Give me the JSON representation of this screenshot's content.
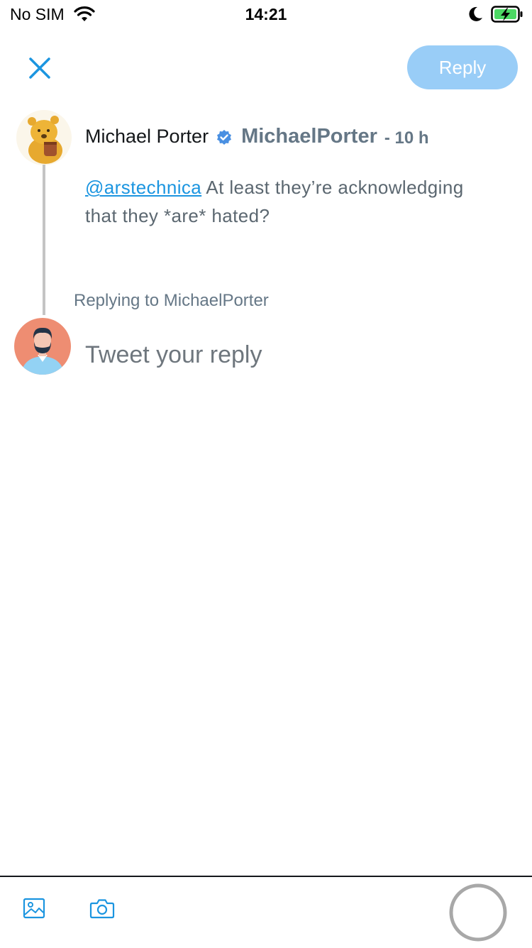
{
  "status_bar": {
    "carrier": "No SIM",
    "time": "14:21",
    "icons": [
      "wifi-icon",
      "moon-icon",
      "battery-charging-icon"
    ]
  },
  "header": {
    "close_icon": "close-icon",
    "reply_button_label": "Reply"
  },
  "tweet": {
    "author_name": "Michael Porter",
    "verified": true,
    "handle": "MichaelPorter",
    "age": "- 10 h",
    "mention": "@arstechnica",
    "text": " At least they’re acknowledging that they *are* hated?"
  },
  "compose": {
    "replying_to": "Replying to MichaelPorter",
    "placeholder": "Tweet your reply"
  },
  "toolbar": {
    "icons": [
      "image-icon",
      "camera-icon",
      "character-count-ring"
    ]
  },
  "colors": {
    "accent": "#1b95e0",
    "reply_button_disabled": "#99cdf7",
    "secondary_text": "#657786",
    "thread_line": "#c4c4c4"
  }
}
